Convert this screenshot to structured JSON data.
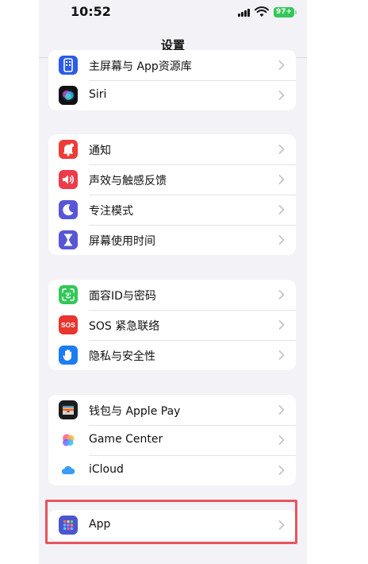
{
  "status_bar": {
    "time": "10:52",
    "battery": "97+"
  },
  "nav": {
    "title": "设置"
  },
  "groups": [
    {
      "items": [
        {
          "label": "主屏幕与 App资源库",
          "icon": "home-screen-icon",
          "color": "#2c5ce6"
        },
        {
          "label": "Siri",
          "icon": "siri-icon",
          "color": "#111111"
        }
      ]
    },
    {
      "items": [
        {
          "label": "通知",
          "icon": "bell-icon",
          "color": "#ee3b37"
        },
        {
          "label": "声效与触感反馈",
          "icon": "speaker-icon",
          "color": "#ee3b4b"
        },
        {
          "label": "专注模式",
          "icon": "moon-icon",
          "color": "#5856d6"
        },
        {
          "label": "屏幕使用时间",
          "icon": "hourglass-icon",
          "color": "#5856d6"
        }
      ]
    },
    {
      "items": [
        {
          "label": "面容ID与密码",
          "icon": "face-id-icon",
          "color": "#34c759"
        },
        {
          "label": "SOS 紧急联络",
          "icon": "sos-icon",
          "color": "#e8352f",
          "badge": "SOS"
        },
        {
          "label": "隐私与安全性",
          "icon": "hand-icon",
          "color": "#1d7cf2"
        }
      ]
    },
    {
      "items": [
        {
          "label": "钱包与 Apple Pay",
          "icon": "wallet-icon",
          "color": "#1c1c1e"
        },
        {
          "label": "Game Center",
          "icon": "game-center-icon",
          "color": "#ffffff"
        },
        {
          "label": "iCloud",
          "icon": "icloud-icon",
          "color": "#ffffff"
        }
      ]
    },
    {
      "items": [
        {
          "label": "App",
          "icon": "apps-grid-icon",
          "color": "#4b55d0"
        }
      ]
    }
  ]
}
